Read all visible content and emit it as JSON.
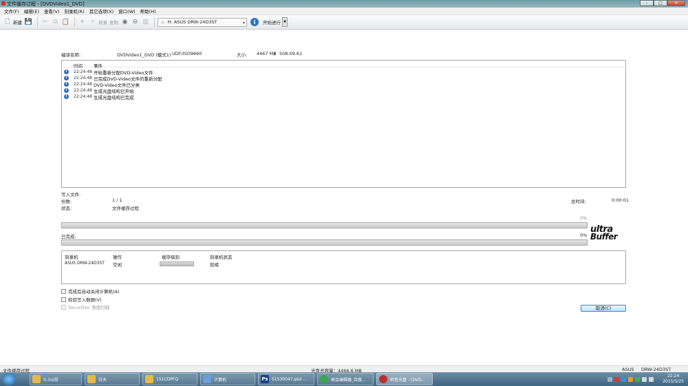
{
  "window": {
    "title": "文件缓存过程 - [DVDVideo1_DVD]",
    "controls": [
      "–",
      "□",
      "✕"
    ]
  },
  "menu": [
    "文件(F)",
    "编辑(E)",
    "查看(V)",
    "刻录机(R)",
    "其它选项(X)",
    "窗口(W)",
    "帮助(H)"
  ],
  "toolbar": {
    "new_label": "新建",
    "burn_label": "刻录",
    "copy_label": "复制",
    "drive_value": "H: ASUS DRW-24D3ST",
    "start_label": "开始进行"
  },
  "info": {
    "compile_name_label": "编译名称:",
    "compile_name_value": "DVDVideo1_DVD (模式1)",
    "format_value": "UDF/ISO9660",
    "size_label": "大小:",
    "size_value": "4467 MB",
    "size_sep": "/",
    "duration_value": "508:09.61"
  },
  "log": {
    "col_time": "时间",
    "col_event": "事件",
    "rows": [
      {
        "time": "22:24:48",
        "event": "开始重新分配DVD-Video文件"
      },
      {
        "time": "22:24:48",
        "event": "已完成DVD-Video文件的重新分配"
      },
      {
        "time": "22:24:48",
        "event": "DVD-Video文件已分类"
      },
      {
        "time": "22:24:48",
        "event": "生成光盘结构已开始"
      },
      {
        "time": "22:24:48",
        "event": "生成光盘结构已完成"
      }
    ]
  },
  "progress": {
    "writing_file_label": "写入文件:",
    "copies_label": "份数:",
    "copies_value": "1 / 1",
    "status_label": "状态:",
    "status_value": "文件缓存过程",
    "elapsed_label": "总时间:",
    "elapsed_value": "0:00:01",
    "bar1_percent_text": "0%",
    "bar1_fraction": 0,
    "completed_label": "已完成:",
    "bar2_percent_text": "0%",
    "bar2_fraction": 0
  },
  "logo": {
    "line1": "ultra",
    "line2": "Buffer"
  },
  "recorders": {
    "col_recorder": "刻录机",
    "col_action": "操作",
    "col_buffer": "缓存级别",
    "col_status": "刻录机状态",
    "rows": [
      {
        "recorder": "ASUS DRW-24D3ST",
        "action": "空闲",
        "buffer_fraction": 0,
        "status": "就绪"
      }
    ]
  },
  "options": {
    "shutdown_label": "完成后自动关闭计算机(A)",
    "verify_label": "校验写入数据(V)",
    "securdisc_label": "SecurDisc 表面扫描"
  },
  "cancel_label": "取消(C)",
  "statusbar": {
    "left": "文件缓存过程",
    "capacity": "光盘总容量：4466.6 MB",
    "drive_short": "ASUS",
    "drive_model": "DRW-24D3ST"
  },
  "taskbar": {
    "items": [
      {
        "label": "S-3以前",
        "icon_color": "#e7b84a"
      },
      {
        "label": "白天",
        "icon_color": "#e7b84a"
      },
      {
        "label": "151CDPFQ",
        "icon_color": "#e7b84a"
      },
      {
        "label": "计算机",
        "icon_color": "#6aa0d8"
      },
      {
        "label": "S1530047.psd ...",
        "icon_color": "#1d3f8f"
      },
      {
        "label": "高会编辑器_百度...",
        "icon_color": "#3aa54a"
      },
      {
        "label": "检查光盘 - [DVD...",
        "icon_color": "#b73030"
      }
    ],
    "time": "22:24",
    "date": "2015/5/25"
  }
}
